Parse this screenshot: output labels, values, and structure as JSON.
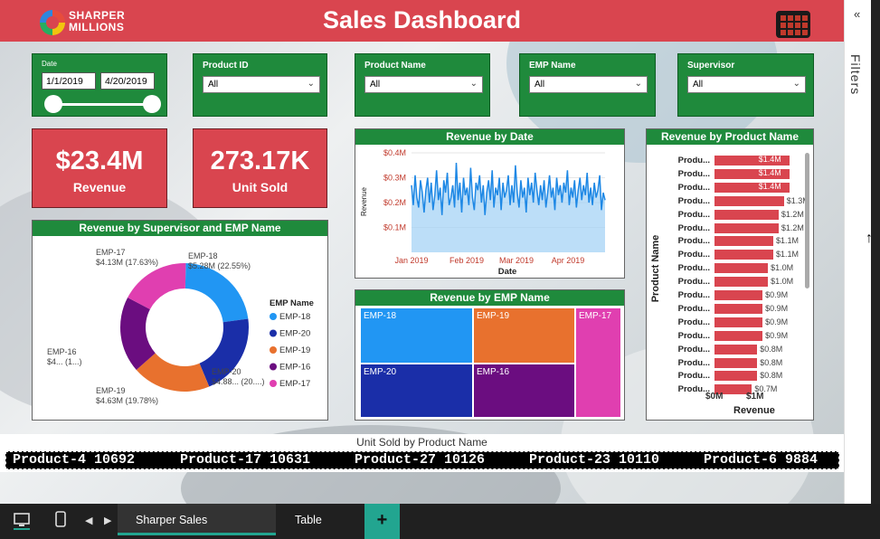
{
  "header": {
    "title": "Sales Dashboard",
    "logo_line1": "SHARPER",
    "logo_line2": "MILLIONS"
  },
  "slicers": {
    "date": {
      "label": "Date",
      "start": "1/1/2019",
      "end": "4/20/2019"
    },
    "product_id": {
      "label": "Product ID",
      "value": "All"
    },
    "product_name": {
      "label": "Product Name",
      "value": "All"
    },
    "emp_name": {
      "label": "EMP Name",
      "value": "All"
    },
    "supervisor": {
      "label": "Supervisor",
      "value": "All"
    }
  },
  "kpis": {
    "revenue": {
      "value": "$23.4M",
      "label": "Revenue"
    },
    "units": {
      "value": "273.17K",
      "label": "Unit Sold"
    }
  },
  "donut": {
    "title": "Revenue by Supervisor and EMP Name",
    "legend_title": "EMP Name",
    "labels": [
      {
        "name": "EMP-18",
        "value": "$5.28M (22.55%)"
      },
      {
        "name": "EMP-17",
        "value": "$4.13M (17.63%)"
      },
      {
        "name": "EMP-16",
        "value": "$4... (1...)"
      },
      {
        "name": "EMP-19",
        "value": "$4.63M (19.78%)"
      },
      {
        "name": "EMP-20",
        "value": "$4.88... (20....)"
      }
    ],
    "legend": [
      {
        "name": "EMP-18",
        "color": "#2196f3"
      },
      {
        "name": "EMP-20",
        "color": "#1a2ea8"
      },
      {
        "name": "EMP-19",
        "color": "#e8712e"
      },
      {
        "name": "EMP-16",
        "color": "#6b0d80"
      },
      {
        "name": "EMP-17",
        "color": "#e03fb0"
      }
    ]
  },
  "chart_data": [
    {
      "type": "line",
      "title": "Revenue by Date",
      "xlabel": "Date",
      "ylabel": "Revenue",
      "x_ticks": [
        "Jan 2019",
        "Feb 2019",
        "Mar 2019",
        "Apr 2019"
      ],
      "y_ticks": [
        "$0.4M",
        "$0.3M",
        "$0.2M",
        "$0.1M"
      ],
      "ylim": [
        0,
        0.4
      ],
      "series": [
        {
          "values": [
            0.27,
            0.19,
            0.31,
            0.22,
            0.18,
            0.29,
            0.24,
            0.16,
            0.25,
            0.3,
            0.2,
            0.28,
            0.17,
            0.23,
            0.33,
            0.21,
            0.26,
            0.15,
            0.29,
            0.24,
            0.32,
            0.19,
            0.22,
            0.27,
            0.18,
            0.36,
            0.21,
            0.28,
            0.16,
            0.3,
            0.23,
            0.26,
            0.19,
            0.34,
            0.22,
            0.17,
            0.28,
            0.25,
            0.31,
            0.2,
            0.27,
            0.15,
            0.24,
            0.29,
            0.21,
            0.33,
            0.18,
            0.26,
            0.23,
            0.3,
            0.17,
            0.28,
            0.22,
            0.25,
            0.31,
            0.19,
            0.27,
            0.2,
            0.35,
            0.24,
            0.18,
            0.29,
            0.22,
            0.26,
            0.16,
            0.3,
            0.23,
            0.28,
            0.2,
            0.32,
            0.25,
            0.19,
            0.27,
            0.21,
            0.29,
            0.18,
            0.24,
            0.31,
            0.22,
            0.26,
            0.17,
            0.3,
            0.23,
            0.27,
            0.2,
            0.28,
            0.24,
            0.33,
            0.19,
            0.26,
            0.22,
            0.29,
            0.18,
            0.25,
            0.3,
            0.21,
            0.27,
            0.23,
            0.32,
            0.2,
            0.26,
            0.19,
            0.28,
            0.22,
            0.25,
            0.31,
            0.17,
            0.24,
            0.21
          ]
        }
      ]
    },
    {
      "type": "bar",
      "title": "Revenue by Product Name",
      "ylabel": "Product Name",
      "xlabel": "Revenue",
      "x_ticks": [
        "$0M",
        "$1M"
      ],
      "xlim": [
        0,
        1.6
      ],
      "categories": [
        "Produ...",
        "Produ...",
        "Produ...",
        "Produ...",
        "Produ...",
        "Produ...",
        "Produ...",
        "Produ...",
        "Produ...",
        "Produ...",
        "Produ...",
        "Produ...",
        "Produ...",
        "Produ...",
        "Produ...",
        "Produ...",
        "Produ...",
        "Produ..."
      ],
      "values": [
        1.4,
        1.4,
        1.4,
        1.3,
        1.2,
        1.2,
        1.1,
        1.1,
        1.0,
        1.0,
        0.9,
        0.9,
        0.9,
        0.9,
        0.8,
        0.8,
        0.8,
        0.7
      ],
      "labels": [
        "$1.4M",
        "$1.4M",
        "$1.4M",
        "$1.3M",
        "$1.2M",
        "$1.2M",
        "$1.1M",
        "$1.1M",
        "$1.0M",
        "$1.0M",
        "$0.9M",
        "$0.9M",
        "$0.9M",
        "$0.9M",
        "$0.8M",
        "$0.8M",
        "$0.8M",
        "$0.7M"
      ]
    },
    {
      "type": "pie",
      "title": "Revenue by Supervisor and EMP Name",
      "categories": [
        "EMP-18",
        "EMP-20",
        "EMP-19",
        "EMP-16",
        "EMP-17"
      ],
      "values": [
        22.55,
        20.85,
        19.78,
        19.19,
        17.63
      ]
    }
  ],
  "treemap": {
    "title": "Revenue by EMP Name",
    "cells": [
      {
        "name": "EMP-18",
        "color": "#2196f3"
      },
      {
        "name": "EMP-19",
        "color": "#e8712e"
      },
      {
        "name": "EMP-17",
        "color": "#e03fb0"
      },
      {
        "name": "EMP-20",
        "color": "#1a2ea8"
      },
      {
        "name": "EMP-16",
        "color": "#6b0d80"
      }
    ]
  },
  "ticker": {
    "title": "Unit Sold by Product Name",
    "items": [
      "Product-4 10692",
      "Product-17 10631",
      "Product-27 10126",
      "Product-23 10110",
      "Product-6 9884"
    ]
  },
  "filters_pane": {
    "label": "Filters",
    "collapse_icon": "«"
  },
  "tabs": {
    "active": "Sharper Sales Dashboard",
    "second": "Table View",
    "add": "+"
  }
}
